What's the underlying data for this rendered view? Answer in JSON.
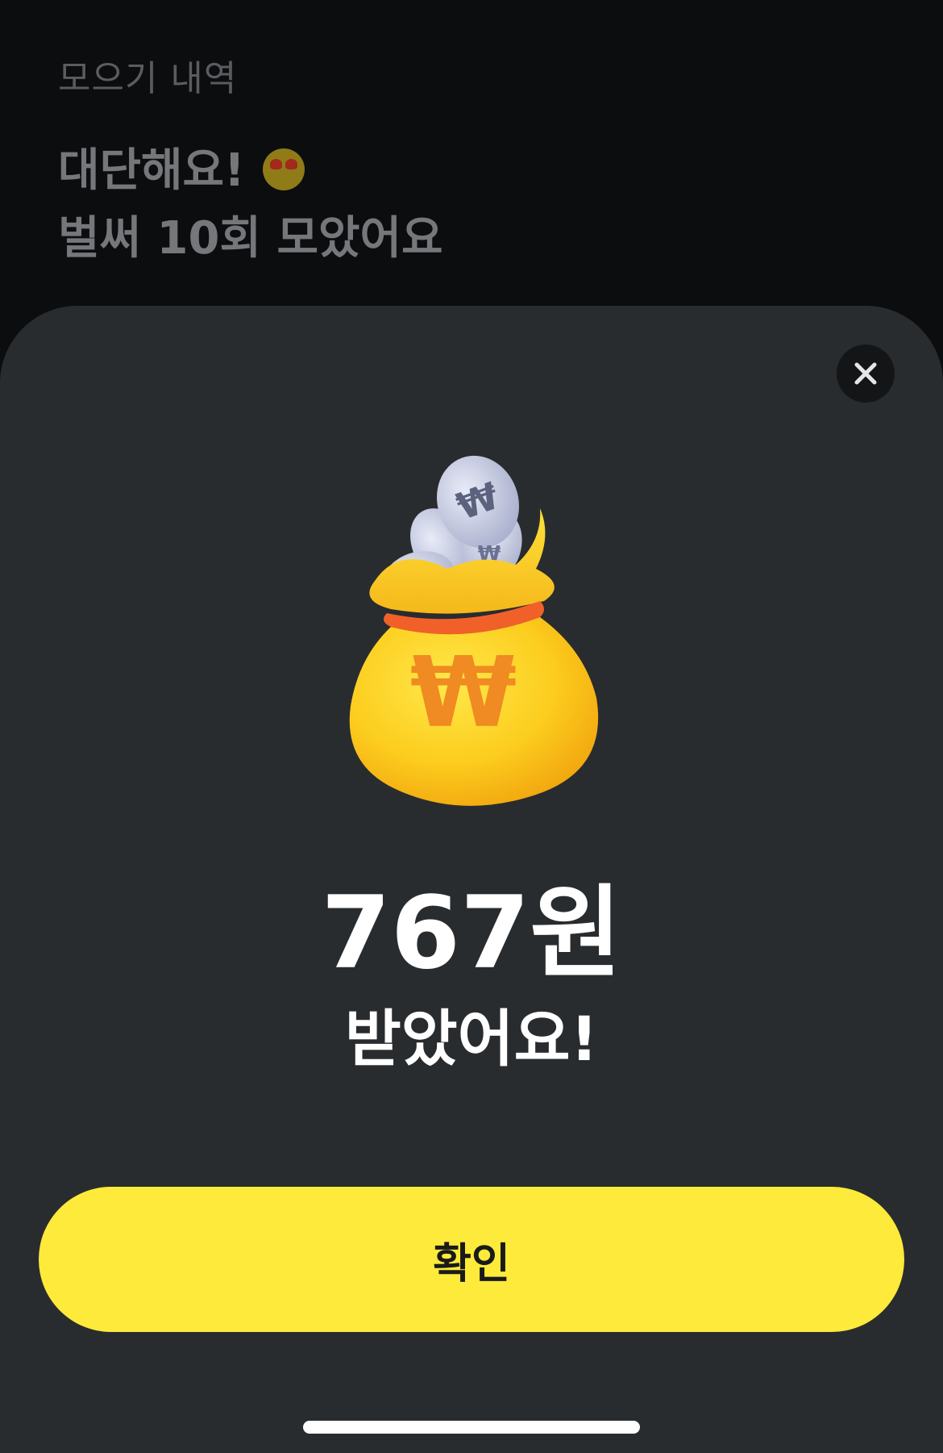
{
  "background": {
    "subtitle": "모으기 내역",
    "headline_line1": "대단해요!",
    "headline_emoji": "heart-eyes-emoji",
    "headline_line2": "벌써 10회 모았어요"
  },
  "sheet": {
    "close_icon": "close-icon",
    "illustration": "money-bag-with-coins",
    "amount": "767원",
    "message": "받았어요!",
    "confirm_label": "확인"
  },
  "colors": {
    "accent": "#fdea3a",
    "sheet_bg": "#292c2f",
    "page_bg": "#0c0d0f"
  }
}
